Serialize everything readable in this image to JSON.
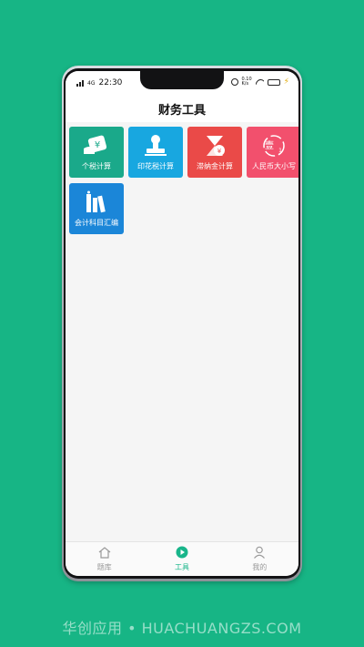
{
  "status_bar": {
    "carrier": "4G",
    "time": "22:30",
    "speed_value": "0.10",
    "speed_unit": "K/s"
  },
  "header": {
    "title": "财务工具"
  },
  "tools": [
    {
      "label": "个税计算",
      "color": "#1aa98a",
      "icon": "tax-money-icon"
    },
    {
      "label": "印花税计算",
      "color": "#18a7e0",
      "icon": "stamp-icon"
    },
    {
      "label": "滞纳金计算",
      "color": "#ea4a48",
      "icon": "hourglass-coin-icon"
    },
    {
      "label": "人民币大小写",
      "color": "#f2506d",
      "icon": "yuan-convert-icon"
    },
    {
      "label": "会计科目汇编",
      "color": "#1b86d8",
      "icon": "books-icon"
    }
  ],
  "tabbar": {
    "items": [
      {
        "label": "题库",
        "icon": "home-icon",
        "active": false
      },
      {
        "label": "工具",
        "icon": "play-icon",
        "active": true
      },
      {
        "label": "我的",
        "icon": "user-icon",
        "active": false
      }
    ]
  },
  "colors": {
    "background": "#17b585",
    "accent": "#18b58a"
  },
  "watermark": "华创应用 • HUACHUANGZS.COM"
}
